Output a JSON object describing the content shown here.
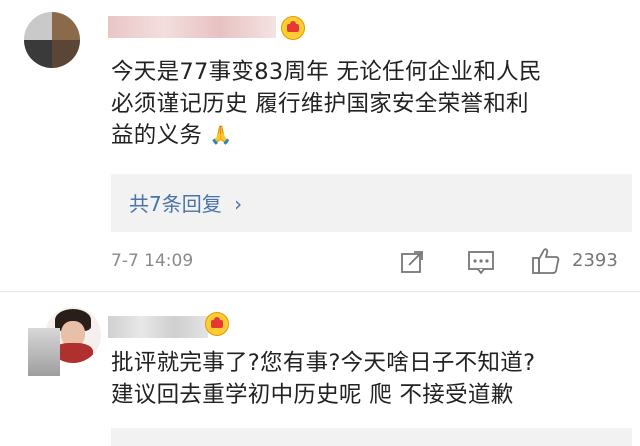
{
  "comments": [
    {
      "content_line1": "今天是77事变83周年 无论任何企业和人民",
      "content_line2": "必须谨记历史 履行维护国家安全荣誉和利",
      "content_line3": "益的义务",
      "emoji": "🙏",
      "reply_label": "共7条回复",
      "reply_chevron": "›",
      "timestamp": "7-7 14:09",
      "likes": "2393"
    },
    {
      "content_line1": "批评就完事了?您有事?今天啥日子不知道?",
      "content_line2": "建议回去重学初中历史呢 爬 不接受道歉"
    }
  ],
  "icons": {
    "share": "share-icon",
    "comment": "comment-icon",
    "like": "thumbs-up-icon",
    "badge": "vip-badge-icon"
  },
  "colors": {
    "link": "#4a74a5",
    "meta": "#8a8a8a",
    "reply_bg": "#f2f2f2"
  }
}
